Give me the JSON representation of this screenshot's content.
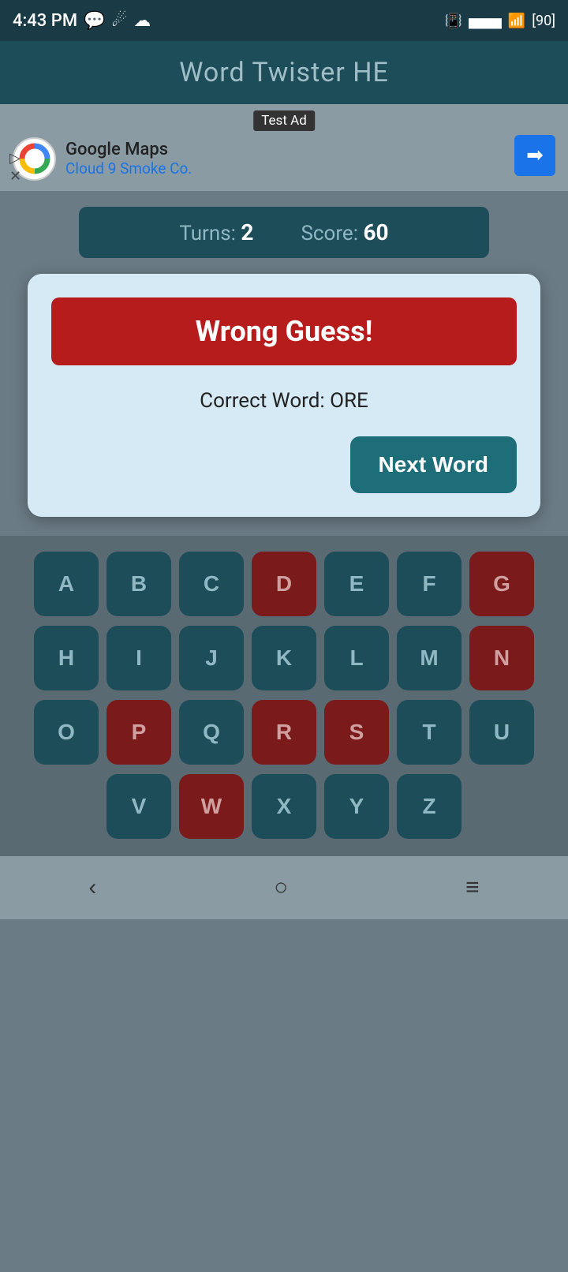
{
  "statusBar": {
    "time": "4:43 PM",
    "battery": "90"
  },
  "header": {
    "title": "Word Twister HE"
  },
  "ad": {
    "label": "Test Ad",
    "company": "Google Maps",
    "subtitle": "Cloud 9 Smoke Co."
  },
  "scoreBar": {
    "turnsLabel": "Turns:",
    "turnsValue": "2",
    "scoreLabel": "Score:",
    "scoreValue": "60"
  },
  "dialog": {
    "wrongGuessText": "Wrong Guess!",
    "correctWordLabel": "Correct Word: ORE",
    "nextWordButton": "Next Word"
  },
  "keyboard": {
    "rows": [
      [
        "A",
        "B",
        "C",
        "D",
        "E",
        "F",
        "G"
      ],
      [
        "H",
        "I",
        "J",
        "K",
        "L",
        "M",
        "N"
      ],
      [
        "O",
        "P",
        "Q",
        "R",
        "S",
        "T",
        "U"
      ],
      [
        "V",
        "W",
        "X",
        "Y",
        "Z"
      ]
    ],
    "redKeys": [
      "D",
      "G",
      "N",
      "P",
      "R",
      "S",
      "W"
    ]
  },
  "bottomNav": {
    "back": "‹",
    "home": "○",
    "menu": "≡"
  }
}
